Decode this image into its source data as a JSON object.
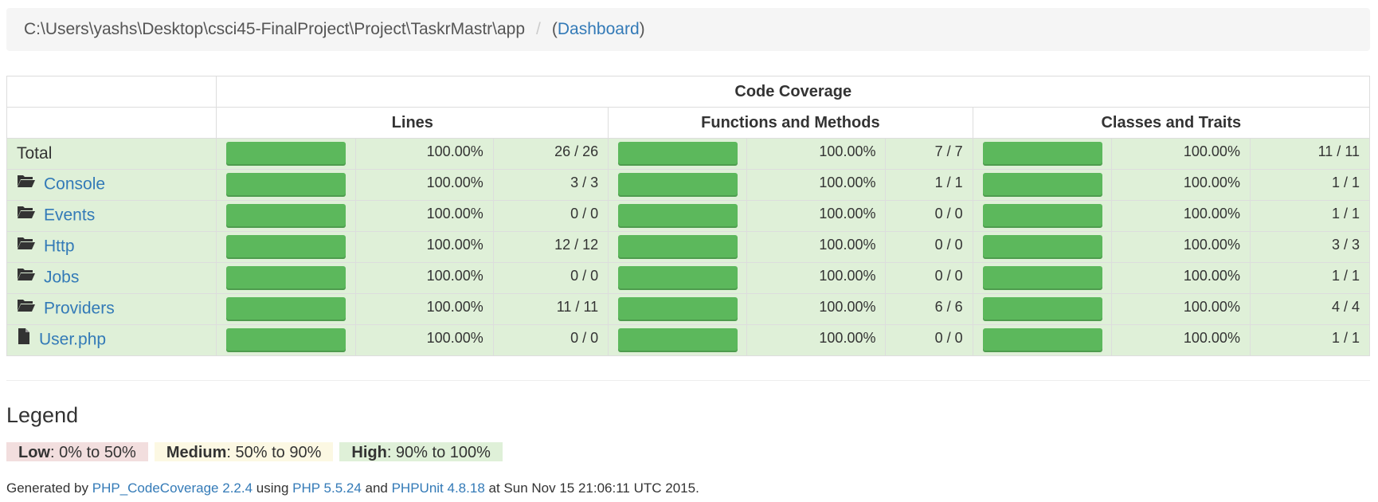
{
  "breadcrumb": {
    "path": "C:\\Users\\yashs\\Desktop\\csci45-FinalProject\\Project\\TaskrMastr\\app",
    "separator": "/",
    "open_paren": "(",
    "dashboard_link": "Dashboard",
    "close_paren": ")"
  },
  "table": {
    "header_top": "Code Coverage",
    "header_lines": "Lines",
    "header_functions": "Functions and Methods",
    "header_classes": "Classes and Traits",
    "bar_color": "#5cb85c",
    "row_color": "#dff0d8",
    "rows": [
      {
        "name": "Total",
        "icon": "none",
        "lines_pct": "100.00%",
        "lines_fill": 1.0,
        "lines_ratio": "26 / 26",
        "func_pct": "100.00%",
        "func_fill": 1.0,
        "func_ratio": "7 / 7",
        "class_pct": "100.00%",
        "class_fill": 1.0,
        "class_ratio": "11 / 11"
      },
      {
        "name": "Console",
        "icon": "folder-open-icon",
        "lines_pct": "100.00%",
        "lines_fill": 1.0,
        "lines_ratio": "3 / 3",
        "func_pct": "100.00%",
        "func_fill": 1.0,
        "func_ratio": "1 / 1",
        "class_pct": "100.00%",
        "class_fill": 1.0,
        "class_ratio": "1 / 1"
      },
      {
        "name": "Events",
        "icon": "folder-open-icon",
        "lines_pct": "100.00%",
        "lines_fill": 1.0,
        "lines_ratio": "0 / 0",
        "func_pct": "100.00%",
        "func_fill": 1.0,
        "func_ratio": "0 / 0",
        "class_pct": "100.00%",
        "class_fill": 1.0,
        "class_ratio": "1 / 1"
      },
      {
        "name": "Http",
        "icon": "folder-open-icon",
        "lines_pct": "100.00%",
        "lines_fill": 1.0,
        "lines_ratio": "12 / 12",
        "func_pct": "100.00%",
        "func_fill": 1.0,
        "func_ratio": "0 / 0",
        "class_pct": "100.00%",
        "class_fill": 1.0,
        "class_ratio": "3 / 3"
      },
      {
        "name": "Jobs",
        "icon": "folder-open-icon",
        "lines_pct": "100.00%",
        "lines_fill": 1.0,
        "lines_ratio": "0 / 0",
        "func_pct": "100.00%",
        "func_fill": 1.0,
        "func_ratio": "0 / 0",
        "class_pct": "100.00%",
        "class_fill": 1.0,
        "class_ratio": "1 / 1"
      },
      {
        "name": "Providers",
        "icon": "folder-open-icon",
        "lines_pct": "100.00%",
        "lines_fill": 1.0,
        "lines_ratio": "11 / 11",
        "func_pct": "100.00%",
        "func_fill": 1.0,
        "func_ratio": "6 / 6",
        "class_pct": "100.00%",
        "class_fill": 1.0,
        "class_ratio": "4 / 4"
      },
      {
        "name": "User.php",
        "icon": "file-icon",
        "lines_pct": "100.00%",
        "lines_fill": 1.0,
        "lines_ratio": "0 / 0",
        "func_pct": "100.00%",
        "func_fill": 1.0,
        "func_ratio": "0 / 0",
        "class_pct": "100.00%",
        "class_fill": 1.0,
        "class_ratio": "1 / 1"
      }
    ]
  },
  "legend": {
    "title": "Legend",
    "low_label": "Low",
    "low_range": ": 0% to 50%",
    "medium_label": "Medium",
    "medium_range": ": 50% to 90%",
    "high_label": "High",
    "high_range": ": 90% to 100%",
    "low_color": "#f2dede",
    "medium_color": "#fcf8e3",
    "high_color": "#dff0d8"
  },
  "footer": {
    "prefix": "Generated by ",
    "tool_link": "PHP_CodeCoverage 2.2.4",
    "using": " using ",
    "php_link": "PHP 5.5.24",
    "and": " and ",
    "phpunit_link": "PHPUnit 4.8.18",
    "suffix": " at Sun Nov 15 21:06:11 UTC 2015."
  }
}
